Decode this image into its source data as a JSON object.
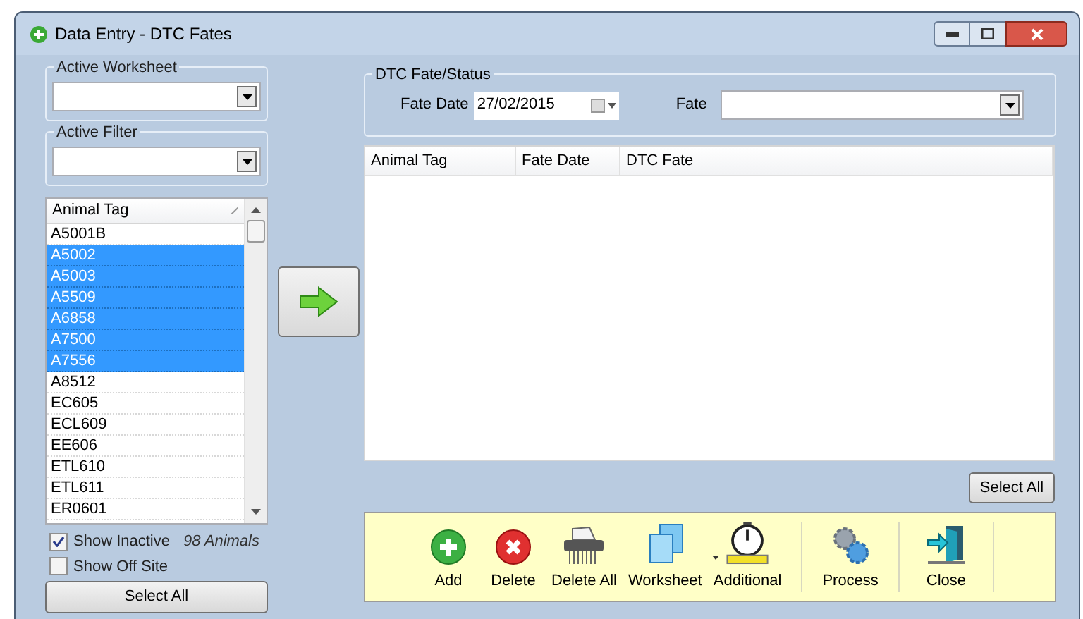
{
  "window": {
    "title": "Data Entry - DTC Fates"
  },
  "active_worksheet": {
    "label": "Active Worksheet"
  },
  "active_filter": {
    "label": "Active Filter"
  },
  "animal_list": {
    "column": "Animal Tag",
    "rows": [
      {
        "tag": "A5001B",
        "selected": false
      },
      {
        "tag": "A5002",
        "selected": true
      },
      {
        "tag": "A5003",
        "selected": true
      },
      {
        "tag": "A5509",
        "selected": true
      },
      {
        "tag": "A6858",
        "selected": true
      },
      {
        "tag": "A7500",
        "selected": true
      },
      {
        "tag": "A7556",
        "selected": true
      },
      {
        "tag": "A8512",
        "selected": false
      },
      {
        "tag": "EC605",
        "selected": false
      },
      {
        "tag": "ECL609",
        "selected": false
      },
      {
        "tag": "EE606",
        "selected": false
      },
      {
        "tag": "ETL610",
        "selected": false
      },
      {
        "tag": "ETL611",
        "selected": false
      },
      {
        "tag": "ER0601",
        "selected": false
      }
    ]
  },
  "options": [
    {
      "label": "Show Inactive",
      "checked": true
    },
    {
      "label": "Show Off Site",
      "checked": false
    }
  ],
  "animal_count": "98 Animals",
  "left_select_all": "Select All",
  "fate_group": {
    "label": "DTC Fate/Status",
    "date_label": "Fate Date",
    "date_value": "27/02/2015",
    "fate_label": "Fate"
  },
  "table": {
    "columns": [
      "Animal Tag",
      "Fate Date",
      "DTC Fate"
    ]
  },
  "right_select_all": "Select All",
  "toolbar": [
    {
      "kind": "add",
      "label": "Add"
    },
    {
      "kind": "delete",
      "label": "Delete"
    },
    {
      "kind": "shredder",
      "label": "Delete All"
    },
    {
      "kind": "worksheet",
      "label": "Worksheet"
    },
    {
      "kind": "stopwatch",
      "label": "Additional"
    },
    {
      "kind": "separator"
    },
    {
      "kind": "gears",
      "label": "Process"
    },
    {
      "kind": "separator"
    },
    {
      "kind": "exit",
      "label": "Close"
    },
    {
      "kind": "separator"
    }
  ]
}
